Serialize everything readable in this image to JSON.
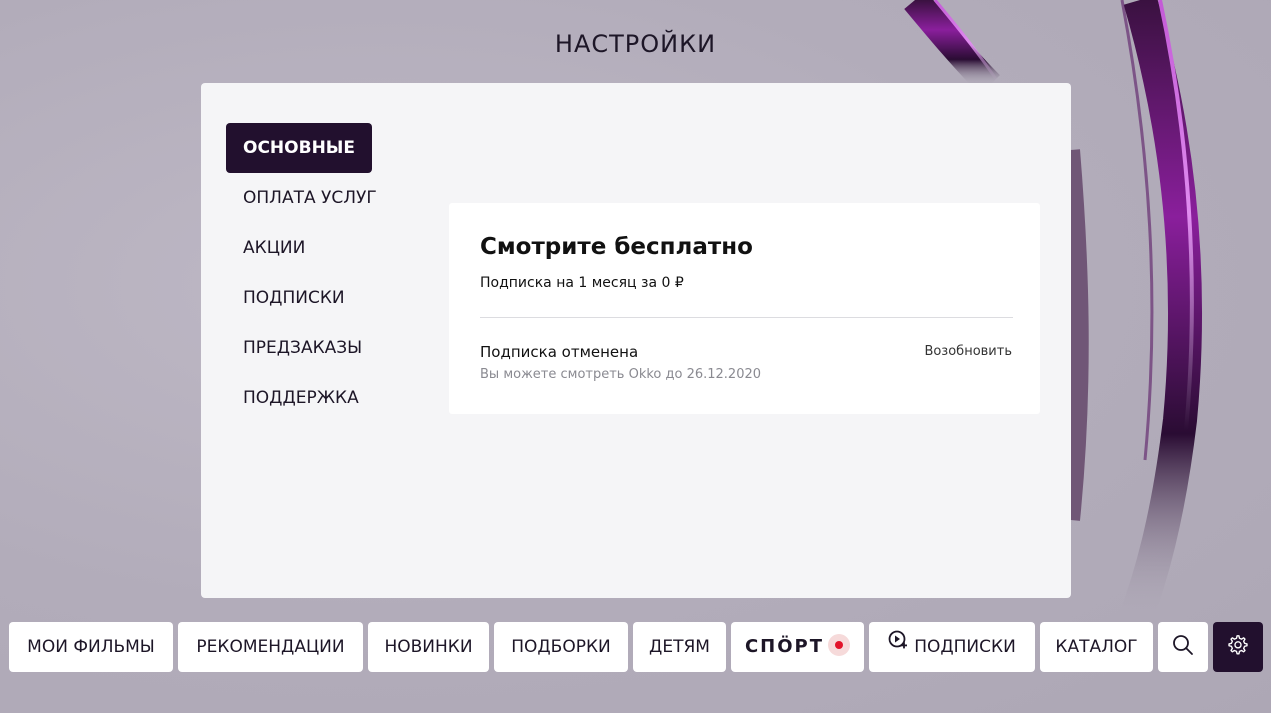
{
  "page": {
    "title": "НАСТРОЙКИ"
  },
  "settings_menu": {
    "items": [
      {
        "label": "ОСНОВНЫЕ",
        "active": true
      },
      {
        "label": "ОПЛАТА УСЛУГ",
        "active": false
      },
      {
        "label": "АКЦИИ",
        "active": false
      },
      {
        "label": "ПОДПИСКИ",
        "active": false
      },
      {
        "label": "ПРЕДЗАКАЗЫ",
        "active": false
      },
      {
        "label": "ПОДДЕРЖКА",
        "active": false
      }
    ]
  },
  "subscription_card": {
    "title": "Смотрите бесплатно",
    "subtitle": "Подписка на 1 месяц за 0 ₽",
    "status": "Подписка отменена",
    "status_note": "Вы можете смотреть Okko до 26.12.2020",
    "renew_label": "Возобновить"
  },
  "bottom_nav": {
    "my_films": "МОИ ФИЛЬМЫ",
    "recommendations": "РЕКОМЕНДАЦИИ",
    "new": "НОВИНКИ",
    "collections": "ПОДБОРКИ",
    "kids": "ДЕТЯМ",
    "sport": "СПÖРТ",
    "subscriptions": "ПОДПИСКИ",
    "catalog": "КАТАЛОГ",
    "search_icon": "search-icon",
    "settings_icon": "gear-icon",
    "subscriptions_icon": "play-plus-icon"
  },
  "colors": {
    "accent_dark": "#22102e",
    "live_red": "#e2142b",
    "background": "#b3adbb",
    "panel": "#f5f5f7"
  }
}
